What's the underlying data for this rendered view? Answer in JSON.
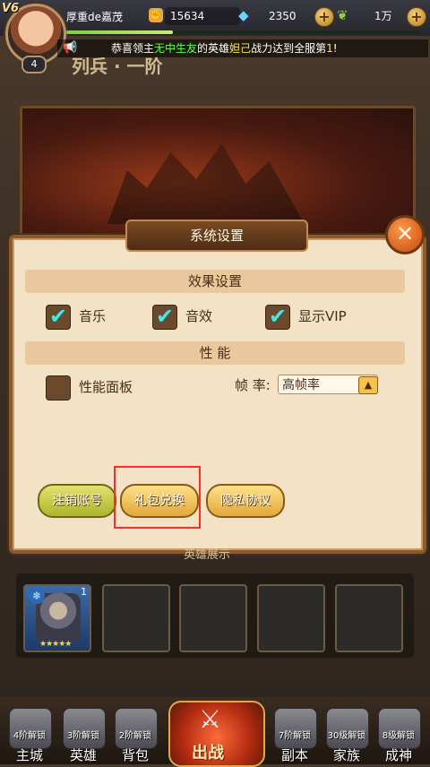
{
  "player": {
    "vip": "V6",
    "level": "4",
    "name": "厚重de嘉茂"
  },
  "resources": {
    "power": "15634",
    "gems": "2350",
    "stamina": "1万"
  },
  "notice": {
    "prefix": "恭喜领主",
    "player": "无中生友",
    "middle": "的英雄",
    "hero": "妲己",
    "suffix": "战力达到全服第",
    "rank": "1",
    "end": "!"
  },
  "background_title": "列兵 · 一阶",
  "dialog": {
    "title": "系统设置",
    "close_symbol": "✕",
    "effects_section": "效果设置",
    "checkboxes": [
      {
        "label": "音乐",
        "checked": true
      },
      {
        "label": "音效",
        "checked": true
      },
      {
        "label": "显示VIP",
        "checked": true
      }
    ],
    "performance_section": "性  能",
    "perf_panel": {
      "label": "性能面板",
      "checked": false
    },
    "frame_rate_label": "帧  率:",
    "frame_rate_value": "高帧率",
    "buttons": {
      "logout": "注销账号",
      "gift": "礼包兑换",
      "privacy": "隐私协议"
    }
  },
  "showcase": {
    "label": "英雄展示",
    "hero_level": "1",
    "stars": "★★★★★"
  },
  "nav": [
    {
      "lock": "4阶解锁",
      "name": "主城"
    },
    {
      "lock": "3阶解锁",
      "name": "英雄"
    },
    {
      "lock": "2阶解锁",
      "name": "背包"
    },
    {
      "lock": "",
      "name": "出战"
    },
    {
      "lock": "7阶解锁",
      "name": "副本"
    },
    {
      "lock": "30级解锁",
      "name": "家族"
    },
    {
      "lock": "8级解锁",
      "name": "成神"
    }
  ],
  "colors": {
    "highlight": "#ff2a2a",
    "check": "#4fe3e0",
    "notice_name": "#5dff4a",
    "notice_hero": "#ffe55a"
  }
}
